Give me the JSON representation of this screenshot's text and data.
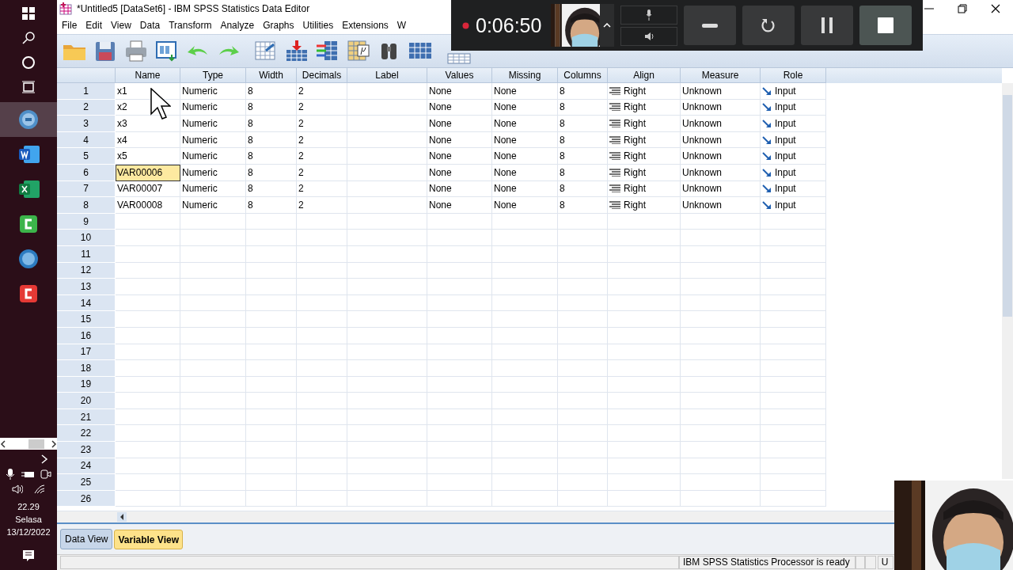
{
  "taskbar": {
    "apps": [
      {
        "kind": "spss",
        "selected": true
      },
      {
        "kind": "word",
        "selected": false
      },
      {
        "kind": "excel",
        "selected": false
      },
      {
        "kind": "camtasia",
        "selected": false
      },
      {
        "kind": "pls",
        "selected": false
      },
      {
        "kind": "recorder",
        "selected": false
      }
    ],
    "clock": {
      "time": "22.29",
      "day": "Selasa",
      "date": "13/12/2022"
    }
  },
  "window": {
    "title": "*Untitled5 [DataSet6] - IBM SPSS Statistics Data Editor"
  },
  "menu": [
    "File",
    "Edit",
    "View",
    "Data",
    "Transform",
    "Analyze",
    "Graphs",
    "Utilities",
    "Extensions",
    "W"
  ],
  "grid": {
    "columns": [
      {
        "label": "Name",
        "kind": "text"
      },
      {
        "label": "Type",
        "kind": "text"
      },
      {
        "label": "Width",
        "kind": "text"
      },
      {
        "label": "Decimals",
        "kind": "text"
      },
      {
        "label": "Label",
        "kind": "text"
      },
      {
        "label": "Values",
        "kind": "text"
      },
      {
        "label": "Missing",
        "kind": "text"
      },
      {
        "label": "Columns",
        "kind": "text"
      },
      {
        "label": "Align",
        "kind": "align"
      },
      {
        "label": "Measure",
        "kind": "text"
      },
      {
        "label": "Role",
        "kind": "role"
      }
    ],
    "rows": [
      {
        "number": "1",
        "selected": false,
        "cells": [
          "x1",
          "Numeric",
          "8",
          "2",
          null,
          "None",
          "None",
          "8",
          "Right",
          "Unknown",
          "Input"
        ]
      },
      {
        "number": "2",
        "selected": false,
        "cells": [
          "x2",
          "Numeric",
          "8",
          "2",
          null,
          "None",
          "None",
          "8",
          "Right",
          "Unknown",
          "Input"
        ]
      },
      {
        "number": "3",
        "selected": false,
        "cells": [
          "x3",
          "Numeric",
          "8",
          "2",
          null,
          "None",
          "None",
          "8",
          "Right",
          "Unknown",
          "Input"
        ]
      },
      {
        "number": "4",
        "selected": false,
        "cells": [
          "x4",
          "Numeric",
          "8",
          "2",
          null,
          "None",
          "None",
          "8",
          "Right",
          "Unknown",
          "Input"
        ]
      },
      {
        "number": "5",
        "selected": false,
        "cells": [
          "x5",
          "Numeric",
          "8",
          "2",
          null,
          "None",
          "None",
          "8",
          "Right",
          "Unknown",
          "Input"
        ]
      },
      {
        "number": "6",
        "selected": true,
        "cells": [
          "VAR00006",
          "Numeric",
          "8",
          "2",
          null,
          "None",
          "None",
          "8",
          "Right",
          "Unknown",
          "Input"
        ]
      },
      {
        "number": "7",
        "selected": false,
        "cells": [
          "VAR00007",
          "Numeric",
          "8",
          "2",
          null,
          "None",
          "None",
          "8",
          "Right",
          "Unknown",
          "Input"
        ]
      },
      {
        "number": "8",
        "selected": false,
        "cells": [
          "VAR00008",
          "Numeric",
          "8",
          "2",
          null,
          "None",
          "None",
          "8",
          "Right",
          "Unknown",
          "Input"
        ]
      },
      {
        "number": "9"
      },
      {
        "number": "10"
      },
      {
        "number": "11"
      },
      {
        "number": "12"
      },
      {
        "number": "13"
      },
      {
        "number": "14"
      },
      {
        "number": "15"
      },
      {
        "number": "16"
      },
      {
        "number": "17"
      },
      {
        "number": "18"
      },
      {
        "number": "19"
      },
      {
        "number": "20"
      },
      {
        "number": "21"
      },
      {
        "number": "22"
      },
      {
        "number": "23"
      },
      {
        "number": "24"
      },
      {
        "number": "25"
      },
      {
        "number": "26"
      }
    ]
  },
  "tabs": [
    {
      "label": "Data View",
      "selected": false
    },
    {
      "label": "Variable View",
      "selected": true
    }
  ],
  "status_bar": {
    "message": "IBM SPSS Statistics Processor is ready",
    "panel": "U"
  },
  "recorder": {
    "elapsed": "0:06:50"
  }
}
